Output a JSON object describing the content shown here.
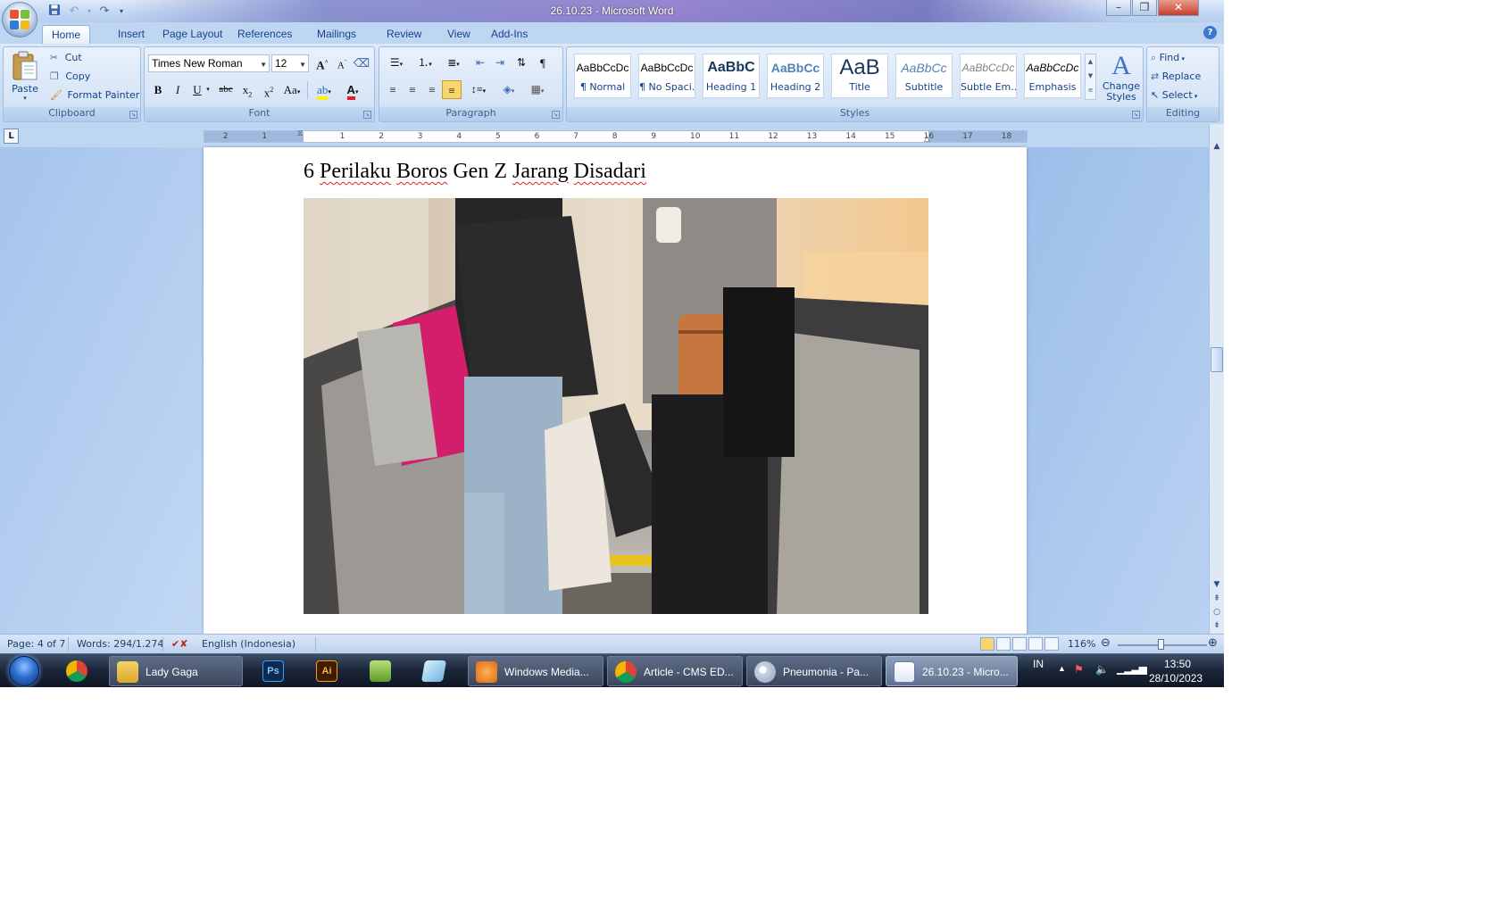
{
  "window": {
    "title": "26.10.23 - Microsoft Word"
  },
  "tabs": [
    "Home",
    "Insert",
    "Page Layout",
    "References",
    "Mailings",
    "Review",
    "View",
    "Add-Ins"
  ],
  "active_tab": "Home",
  "clipboard": {
    "paste": "Paste",
    "cut": "Cut",
    "copy": "Copy",
    "format_painter": "Format Painter",
    "label": "Clipboard"
  },
  "font": {
    "name": "Times New Roman",
    "size": "12",
    "label": "Font"
  },
  "paragraph": {
    "label": "Paragraph"
  },
  "styles": {
    "label": "Styles",
    "items": [
      {
        "sample": "AaBbCcDc",
        "name": "¶ Normal"
      },
      {
        "sample": "AaBbCcDc",
        "name": "¶ No Spaci..."
      },
      {
        "sample": "AaBbC",
        "name": "Heading 1"
      },
      {
        "sample": "AaBbCc",
        "name": "Heading 2"
      },
      {
        "sample": "AaB",
        "name": "Title"
      },
      {
        "sample": "AaBbCc",
        "name": "Subtitle"
      },
      {
        "sample": "AaBbCcDc",
        "name": "Subtle Em..."
      },
      {
        "sample": "AaBbCcDc",
        "name": "Emphasis"
      }
    ],
    "change_styles": "Change Styles"
  },
  "editing": {
    "find": "Find",
    "replace": "Replace",
    "select": "Select",
    "label": "Editing"
  },
  "ruler": {
    "numbers": [
      "2",
      "1",
      "1",
      "2",
      "3",
      "4",
      "5",
      "6",
      "7",
      "8",
      "9",
      "10",
      "11",
      "12",
      "13",
      "14",
      "15",
      "16",
      "17",
      "18"
    ]
  },
  "document": {
    "heading": {
      "part1": "6 ",
      "w1": "Perilaku",
      "sp1": " ",
      "w2": "Boros",
      "part2": " Gen Z ",
      "w3": "Jarang",
      "sp2": " ",
      "w4": "Disadari"
    }
  },
  "statusbar": {
    "page": "Page: 4 of 7",
    "words": "Words: 294/1.274",
    "language": "English (Indonesia)",
    "zoom": "116%"
  },
  "taskbar": {
    "items": [
      {
        "label": "Lady Gaga"
      },
      {
        "label": "Windows Media..."
      },
      {
        "label": "Article - CMS ED..."
      },
      {
        "label": "Pneumonia - Pa..."
      },
      {
        "label": "26.10.23 - Micro..."
      }
    ],
    "ps": "Ps",
    "ai": "Ai",
    "lang": "IN",
    "time": "13:50",
    "date": "28/10/2023"
  }
}
